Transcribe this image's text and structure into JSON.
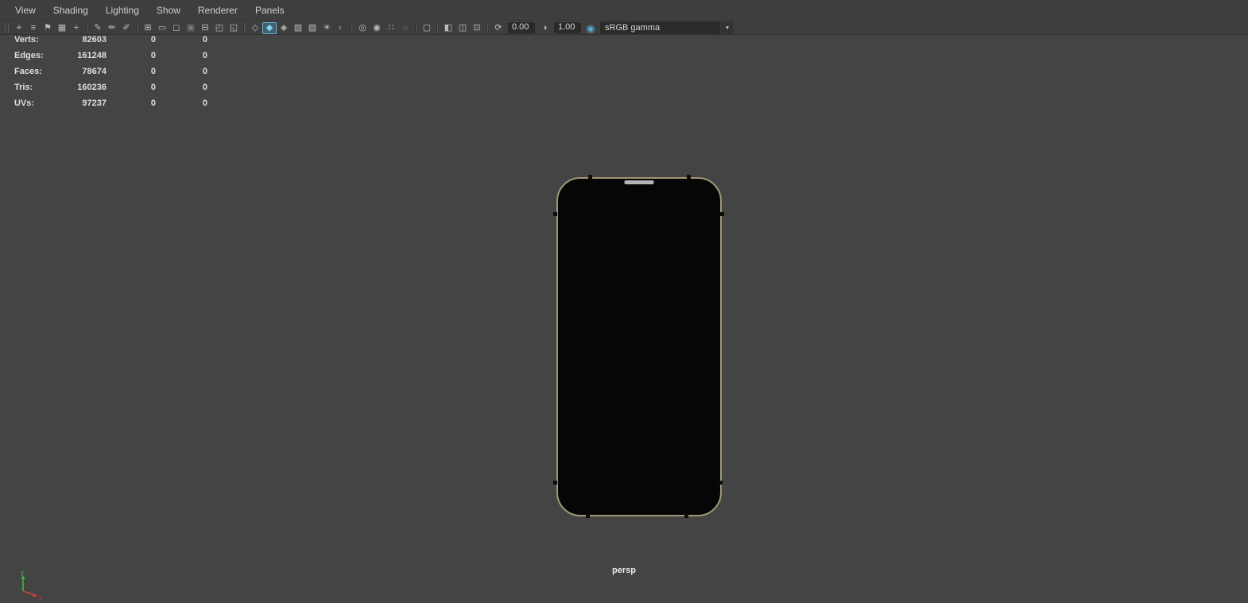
{
  "menu_bar": {
    "items": [
      "View",
      "Shading",
      "Lighting",
      "Show",
      "Renderer",
      "Panels"
    ]
  },
  "toolbar": {
    "icons": [
      {
        "name": "select-camera-icon",
        "glyph": "⌖"
      },
      {
        "name": "camera-attributes-icon",
        "glyph": "≡"
      },
      {
        "name": "bookmark-icon",
        "glyph": "⚑"
      },
      {
        "name": "image-plane-icon",
        "glyph": "▦"
      },
      {
        "name": "two-d-pan-zoom-icon",
        "glyph": "+"
      },
      {
        "name": "grease-pencil-icon",
        "glyph": "✎"
      },
      {
        "name": "paint-tool-icon",
        "glyph": "✏"
      },
      {
        "name": "marker-tool-icon",
        "glyph": "✐"
      },
      {
        "name": "grid-icon",
        "glyph": "⊞"
      },
      {
        "name": "film-gate-icon",
        "glyph": "▭"
      },
      {
        "name": "resolution-gate-icon",
        "glyph": "◻"
      },
      {
        "name": "gate-mask-icon",
        "glyph": "▣"
      },
      {
        "name": "field-chart-icon",
        "glyph": "⊟"
      },
      {
        "name": "safe-action-icon",
        "glyph": "◰"
      },
      {
        "name": "safe-title-icon",
        "glyph": "◱"
      },
      {
        "name": "wireframe-icon",
        "glyph": "◇"
      },
      {
        "name": "smooth-shade-icon",
        "glyph": "◆"
      },
      {
        "name": "wireframe-on-shaded-icon",
        "glyph": "◈"
      },
      {
        "name": "textured-icon",
        "glyph": "▧"
      },
      {
        "name": "use-default-material-icon",
        "glyph": "▨"
      },
      {
        "name": "use-all-lights-icon",
        "glyph": "☀"
      },
      {
        "name": "shadows-icon",
        "glyph": "◐"
      },
      {
        "name": "screen-space-ao-icon",
        "glyph": "◎"
      },
      {
        "name": "motion-blur-icon",
        "glyph": "◉"
      },
      {
        "name": "multisample-icon",
        "glyph": "∷"
      },
      {
        "name": "depth-of-field-icon",
        "glyph": "○"
      },
      {
        "name": "isolate-select-icon",
        "glyph": "▢"
      },
      {
        "name": "single-pane-icon",
        "glyph": "◧"
      },
      {
        "name": "two-pane-icon",
        "glyph": "◫"
      },
      {
        "name": "outliner-pane-icon",
        "glyph": "⊡"
      },
      {
        "name": "exposure-icon",
        "glyph": "⟳"
      },
      {
        "name": "gamma-icon",
        "glyph": "◑"
      },
      {
        "name": "color-management-icon",
        "glyph": "◉"
      },
      {
        "name": "dropdown-arrow-icon",
        "glyph": "▼"
      }
    ],
    "exposure_value": "0.00",
    "gamma_value": "1.00",
    "view_transform": "sRGB gamma"
  },
  "hud": {
    "rows": [
      {
        "label": "Verts:",
        "total": "82603",
        "col2": "0",
        "col3": "0"
      },
      {
        "label": "Edges:",
        "total": "161248",
        "col2": "0",
        "col3": "0"
      },
      {
        "label": "Faces:",
        "total": "78674",
        "col2": "0",
        "col3": "0"
      },
      {
        "label": "Tris:",
        "total": "160236",
        "col2": "0",
        "col3": "0"
      },
      {
        "label": "UVs:",
        "total": "97237",
        "col2": "0",
        "col3": "0"
      }
    ]
  },
  "viewport": {
    "camera_label": "persp",
    "axis_labels": {
      "y": "y",
      "x": "x"
    }
  },
  "colors": {
    "background": "#444444",
    "bar_background": "#3e3e3e",
    "active_icon_accent": "#7fd4ee",
    "phone_outline": "#a09873",
    "axis_y": "#3fbf3f",
    "axis_x": "#cf3f3f"
  }
}
